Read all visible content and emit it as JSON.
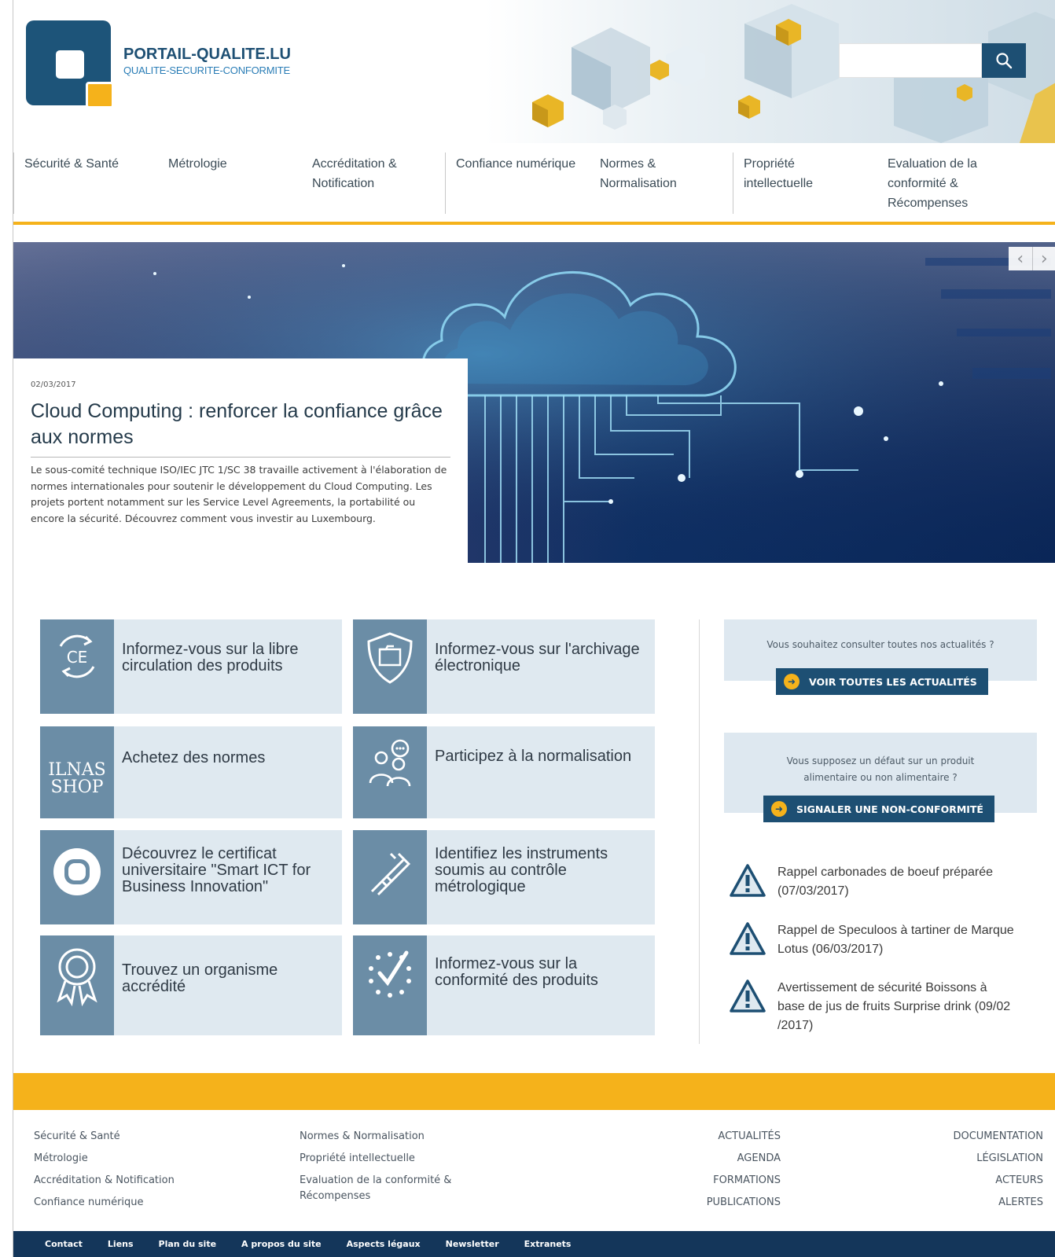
{
  "header": {
    "logo_title": "PORTAIL-QUALITE.LU",
    "logo_subtitle": "QUALITE-SECURITE-CONFORMITE",
    "search": {
      "placeholder": ""
    }
  },
  "nav": {
    "items": [
      {
        "label": "Sécurité & Santé"
      },
      {
        "label": "Métrologie"
      },
      {
        "label": "Accréditation & Notification"
      },
      {
        "label": "Confiance numérique"
      },
      {
        "label": "Normes & Normalisation"
      },
      {
        "label": "Propriété intellectuelle"
      },
      {
        "label": "Evaluation de la conformité & Récompenses"
      }
    ]
  },
  "hero": {
    "date": "02/03/2017",
    "title": "Cloud Computing : renforcer la confiance grâce aux normes",
    "text": "Le sous-comité technique ISO/IEC JTC 1/SC 38 travaille activement à l'élaboration de normes internationales pour soutenir le développement du Cloud Computing. Les projets portent notamment sur les Service Level Agreements, la portabilité ou encore la sécurité. Découvrez comment vous investir au Luxembourg.",
    "prev_symbol": "‹",
    "next_symbol": "›"
  },
  "tiles": [
    {
      "label": "Informez-vous sur la libre circulation des produits",
      "icon": "ce-marking-icon"
    },
    {
      "label": "Informez-vous sur l'archivage électronique",
      "icon": "shield-folder-icon"
    },
    {
      "label": "Achetez des normes",
      "icon": "ilnas-shop-logo",
      "logo_line1": "ILNAS",
      "logo_line2": "SHOP"
    },
    {
      "label": "Participez à la normalisation",
      "icon": "people-discussion-icon"
    },
    {
      "label": "Découvrez le certificat universitaire \"Smart ICT for Business Innovation\"",
      "icon": "certificate-logo-icon"
    },
    {
      "label": "Identifiez les instruments soumis au contrôle métrologique",
      "icon": "caliper-icon"
    },
    {
      "label": "Trouvez un organisme accrédité",
      "icon": "award-ribbon-icon"
    },
    {
      "label": "Informez-vous sur la conformité des produits",
      "icon": "check-stars-icon"
    }
  ],
  "sidebar": {
    "news_box": {
      "text": "Vous souhaitez consulter toutes nos actualités ?",
      "button": "VOIR TOUTES LES ACTUALITÉS"
    },
    "report_box": {
      "text": "Vous supposez un défaut sur un produit alimentaire ou non alimentaire ?",
      "button": "SIGNALER UNE NON-CONFORMITÉ"
    },
    "alerts": [
      {
        "text": "Rappel carbonades de boeuf préparée (07/03/2017)"
      },
      {
        "text": "Rappel de Speculoos à tartiner de Marque Lotus (06/03/2017)"
      },
      {
        "text": "Avertissement de sécurité Boissons à base de jus de fruits Surprise drink (09/02 /2017)"
      }
    ]
  },
  "footer": {
    "col1": [
      "Sécurité & Santé",
      "Métrologie",
      "Accréditation & Notification",
      "Confiance numérique"
    ],
    "col2": [
      "Normes & Normalisation",
      "Propriété intellectuelle",
      "Evaluation de la conformité & Récompenses"
    ],
    "col3": [
      "ACTUALITÉS",
      "AGENDA",
      "FORMATIONS",
      "PUBLICATIONS"
    ],
    "col4": [
      "DOCUMENTATION",
      "LÉGISLATION",
      "ACTEURS",
      "ALERTES"
    ],
    "bottom_links": [
      "Contact",
      "Liens",
      "Plan du site",
      "A propos du site",
      "Aspects légaux",
      "Newsletter",
      "Extranets"
    ]
  },
  "colors": {
    "brand_blue": "#1d4f73",
    "accent_yellow": "#f5b21b",
    "tile_bg": "#dfe9f0",
    "tile_icon_bg": "#6b8da6"
  }
}
